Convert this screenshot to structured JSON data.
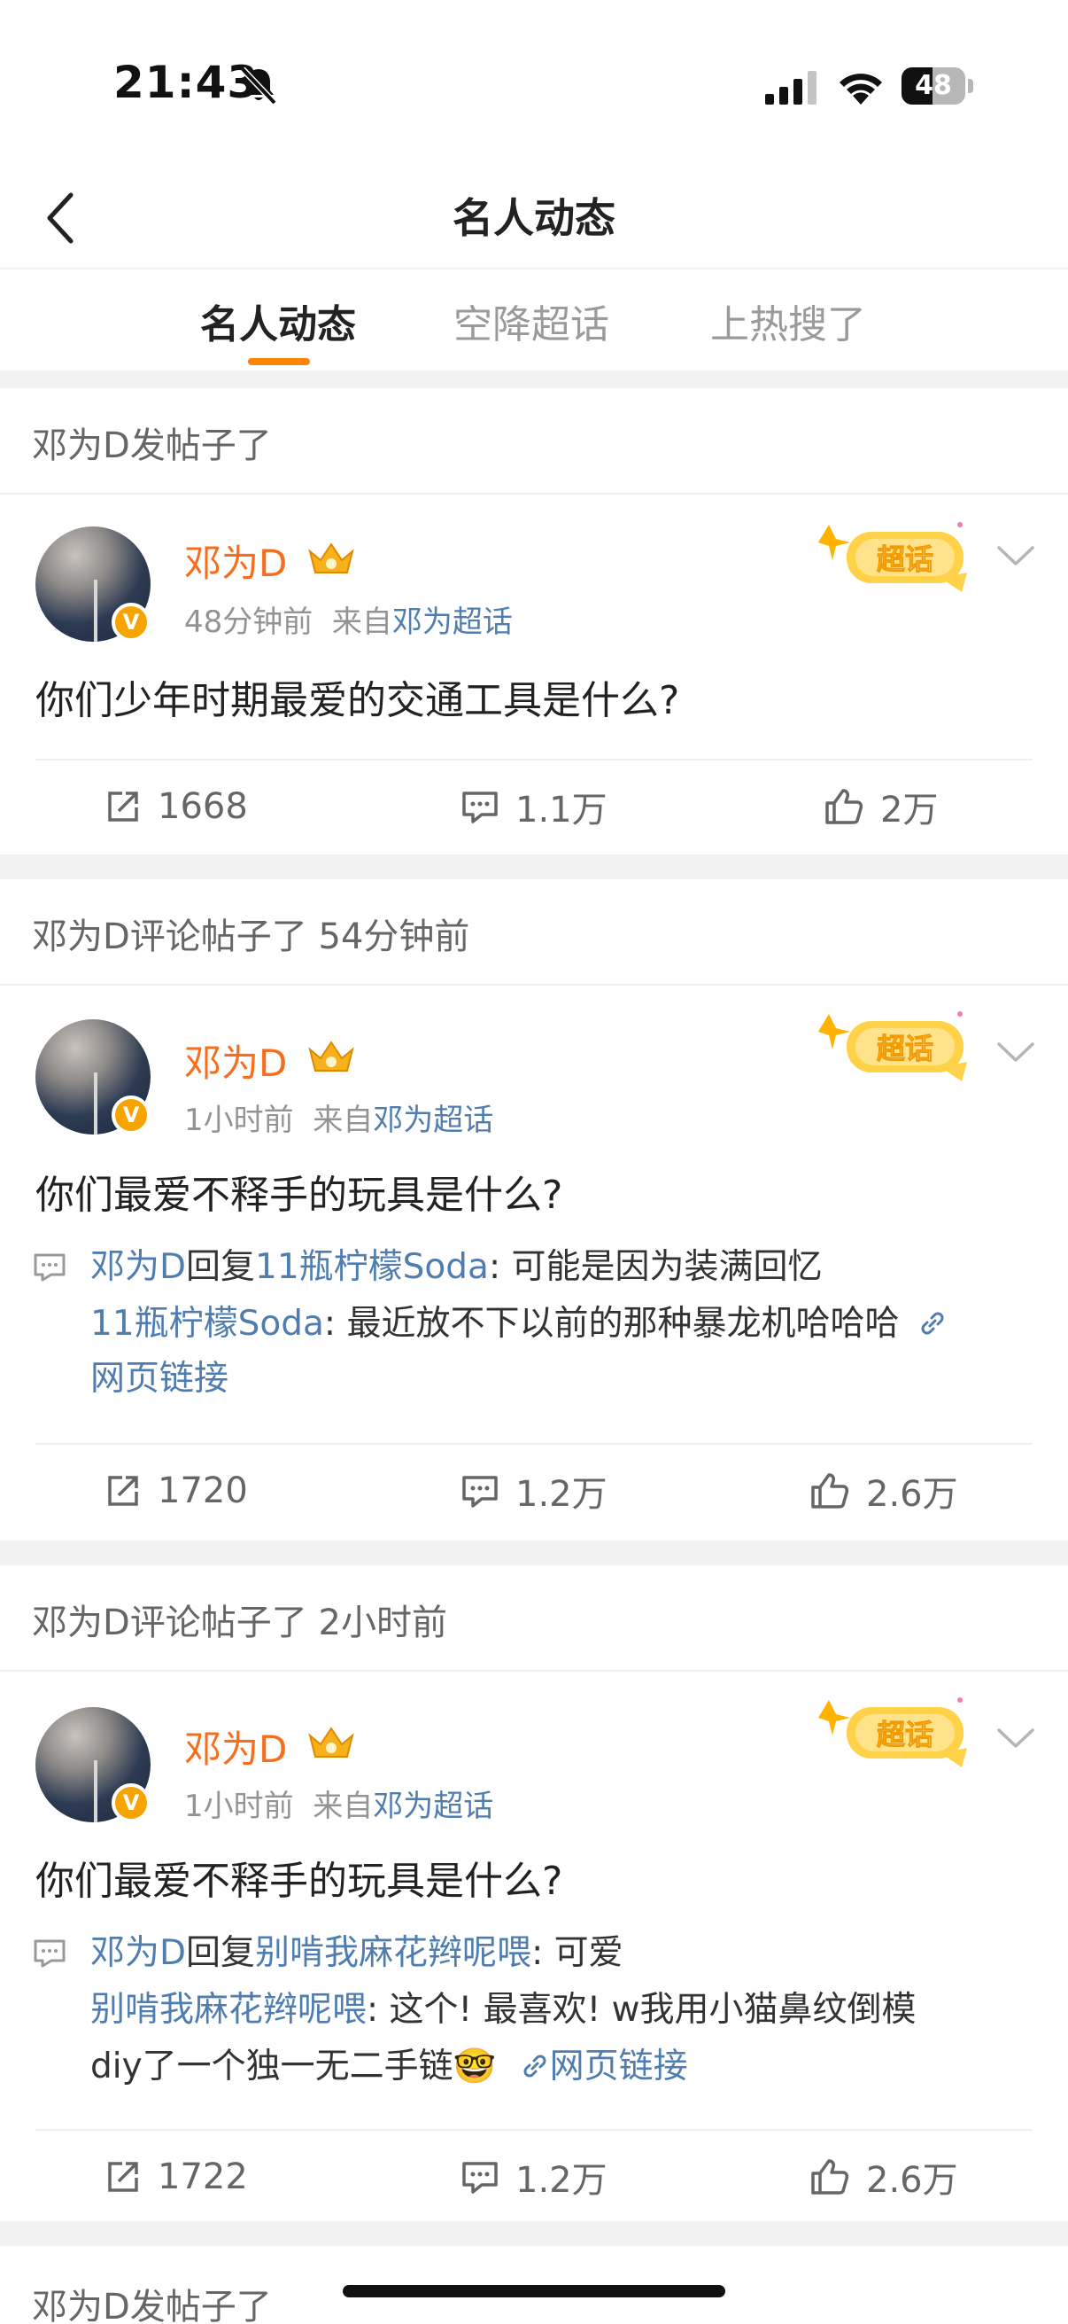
{
  "status_bar": {
    "time": "21:43",
    "battery": "48",
    "battery_level": 0.48
  },
  "nav": {
    "title": "名人动态"
  },
  "tabs": [
    {
      "label": "名人动态",
      "active": true
    },
    {
      "label": "空降超话",
      "active": false
    },
    {
      "label": "上热搜了",
      "active": false
    }
  ],
  "sections": [
    {
      "header": "邓为D发帖子了",
      "post": {
        "username": "邓为D",
        "time": "48分钟前",
        "from_label": "来自",
        "source": "邓为超话",
        "badge": "超话",
        "text": "你们少年时期最爱的交通工具是什么?",
        "actions": {
          "share": "1668",
          "comment": "1.1万",
          "like": "2万"
        }
      }
    },
    {
      "header": "邓为D评论帖子了 54分钟前",
      "post": {
        "username": "邓为D",
        "time": "1小时前",
        "from_label": "来自",
        "source": "邓为超话",
        "badge": "超话",
        "text": "你们最爱不释手的玩具是什么?",
        "quote": {
          "author": "邓为D",
          "reply_word": "回复",
          "target": "11瓶柠檬Soda",
          "reply_text": ": 可能是因为装满回忆",
          "orig_author": "11瓶柠檬Soda",
          "orig_text": ": 最近放不下以前的那种暴龙机哈哈哈",
          "link_text": "网页链接"
        },
        "actions": {
          "share": "1720",
          "comment": "1.2万",
          "like": "2.6万"
        }
      }
    },
    {
      "header": "邓为D评论帖子了 2小时前",
      "post": {
        "username": "邓为D",
        "time": "1小时前",
        "from_label": "来自",
        "source": "邓为超话",
        "badge": "超话",
        "text": "你们最爱不释手的玩具是什么?",
        "quote": {
          "author": "邓为D",
          "reply_word": "回复",
          "target": "别啃我麻花辫呢喂",
          "reply_text": ": 可爱",
          "orig_author": "别啃我麻花辫呢喂",
          "orig_text": ": 这个! 最喜欢! w我用小猫鼻纹倒模",
          "orig_text_2": "diy了一个独一无二手链",
          "emoji": "🤓",
          "link_text": "网页链接"
        },
        "actions": {
          "share": "1722",
          "comment": "1.2万",
          "like": "2.6万"
        }
      }
    },
    {
      "header": "邓为D发帖子了"
    }
  ],
  "colors": {
    "accent": "#ff8200",
    "username": "#f86d1c",
    "link": "#507daf"
  }
}
